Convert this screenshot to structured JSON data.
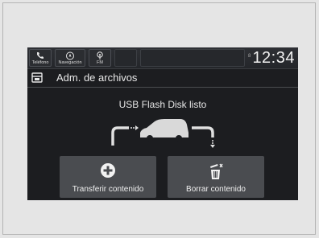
{
  "statusbar": {
    "phone_label": "Teléfono",
    "nav_label": "Navegación",
    "fm_label": "FM",
    "clock_tag": "8",
    "clock": "12:34"
  },
  "header": {
    "title": "Adm. de archivos"
  },
  "main": {
    "status_message": "USB Flash Disk listo"
  },
  "actions": {
    "transfer_label": "Transferir contenido",
    "delete_label": "Borrar contenido"
  },
  "icons": {
    "phone": "phone-icon",
    "navigation": "compass-icon",
    "fm": "radio-icon",
    "file_manager": "folder-icon",
    "transfer": "plus-circle-icon",
    "delete": "trash-icon",
    "vehicle": "car-icon"
  }
}
